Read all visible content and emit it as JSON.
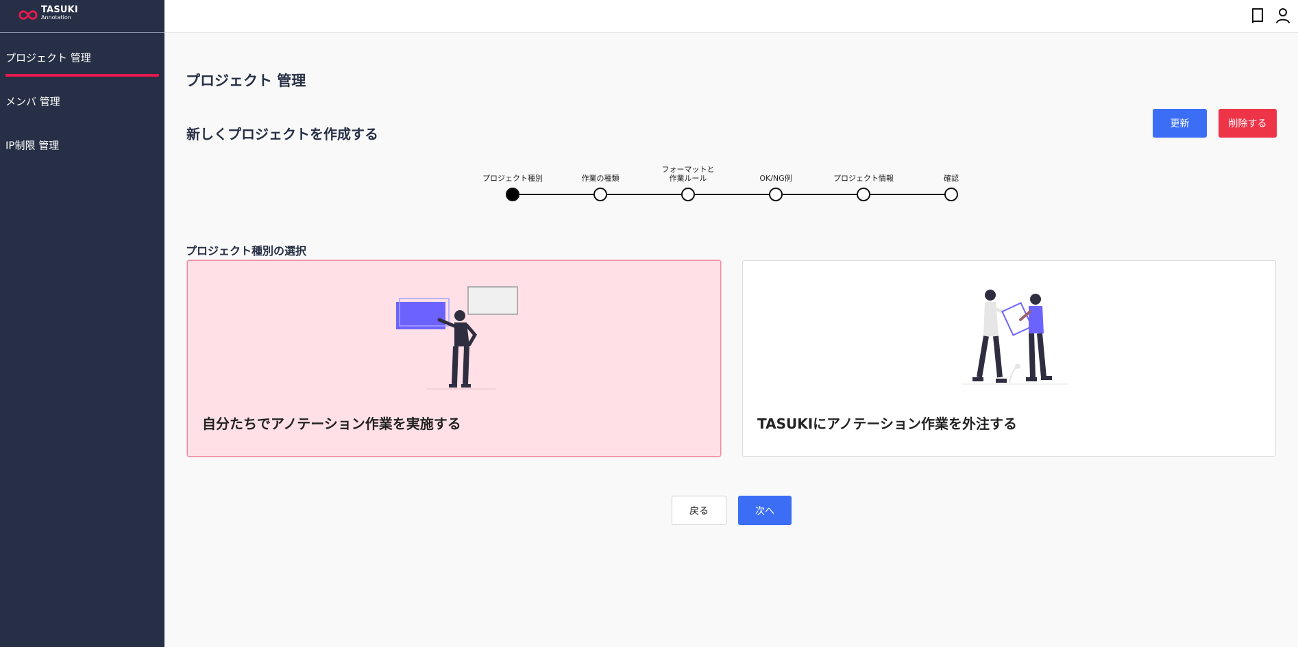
{
  "logo": {
    "title": "TASUKI",
    "subtitle": "Annotation"
  },
  "sidebar": {
    "items": [
      {
        "label": "プロジェクト 管理",
        "active": true
      },
      {
        "label": "メンバ 管理",
        "active": false
      },
      {
        "label": "IP制限 管理",
        "active": false
      }
    ]
  },
  "header": {
    "icons": [
      "book-icon",
      "user-icon"
    ]
  },
  "page": {
    "title": "プロジェクト 管理",
    "section_title": "新しくプロジェクトを作成する",
    "update_label": "更新",
    "delete_label": "削除する"
  },
  "stepper": {
    "current": 0,
    "steps": [
      {
        "label": "プロジェクト種別"
      },
      {
        "label": "作業の種類"
      },
      {
        "label": "フォーマットと\n作業ルール"
      },
      {
        "label": "OK/NG例"
      },
      {
        "label": "プロジェクト情報"
      },
      {
        "label": "確認"
      }
    ]
  },
  "selection": {
    "title": "プロジェクト種別の選択",
    "options": [
      {
        "label": "自分たちでアノテーション作業を実施する",
        "selected": true
      },
      {
        "label": "TASUKIにアノテーション作業を外注する",
        "selected": false
      }
    ]
  },
  "footer": {
    "back_label": "戻る",
    "next_label": "次へ"
  },
  "colors": {
    "sidebar": "#262f45",
    "accent": "#e8194c",
    "primary": "#3b6ef5",
    "danger": "#ee3548",
    "selected_card": "#ffe0e6",
    "illustration": "#6c63ff"
  }
}
